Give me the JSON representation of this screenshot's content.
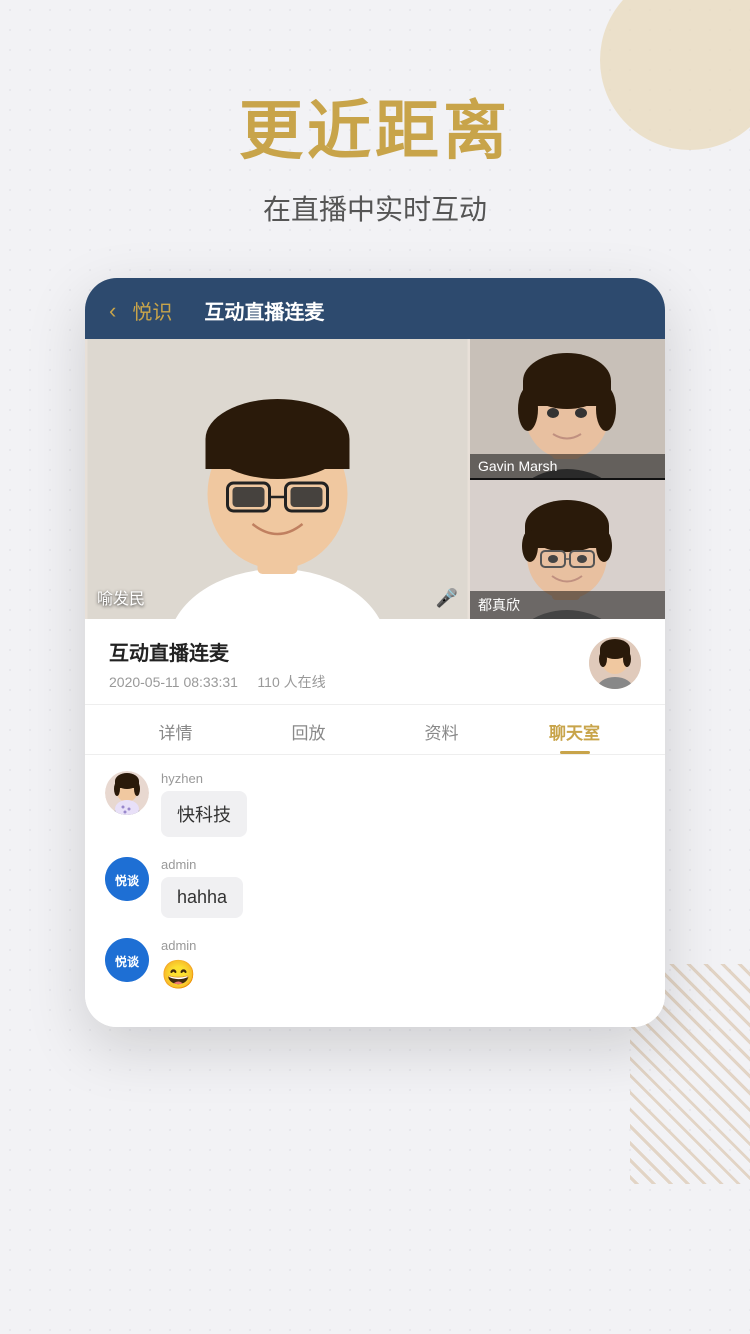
{
  "background": {
    "color": "#f2f2f5"
  },
  "headline": "更近距离",
  "subtitle": "在直播中实时互动",
  "app": {
    "header": {
      "back_icon": "‹",
      "title_left": "悦识",
      "title_center": "互动直播连麦"
    },
    "video": {
      "main_person_name": "喻发民",
      "mic_icon": "🎤",
      "side_person1_name": "Gavin Marsh",
      "side_person2_name": "都真欣"
    },
    "info": {
      "title": "互动直播连麦",
      "date": "2020-05-11 08:33:31",
      "online_count": "110 人在线"
    },
    "tabs": [
      {
        "label": "详情",
        "active": false
      },
      {
        "label": "回放",
        "active": false
      },
      {
        "label": "资料",
        "active": false
      },
      {
        "label": "聊天室",
        "active": true
      }
    ],
    "chat": {
      "messages": [
        {
          "username": "hyzhen",
          "avatar_type": "photo",
          "bubble": "快科技"
        },
        {
          "username": "admin",
          "avatar_type": "logo",
          "logo_text": "悦谈",
          "bubble": "hahha"
        },
        {
          "username": "admin",
          "avatar_type": "logo",
          "logo_text": "悦谈",
          "bubble": "emoji"
        }
      ]
    }
  }
}
